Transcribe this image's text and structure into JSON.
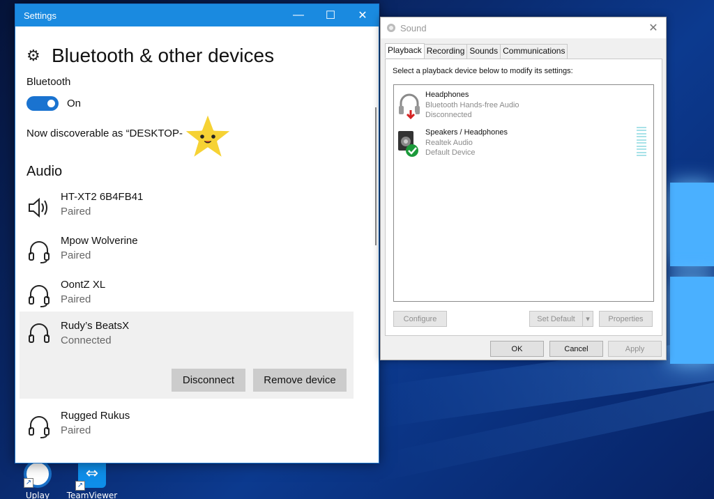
{
  "settings": {
    "window_title": "Settings",
    "page_title": "Bluetooth & other devices",
    "bluetooth_label": "Bluetooth",
    "bluetooth_state": "On",
    "discoverable_text": "Now discoverable as “DESKTOP-",
    "audio_heading": "Audio",
    "devices": [
      {
        "name": "HT-XT2 6B4FB41",
        "status": "Paired",
        "icon": "speaker-icon"
      },
      {
        "name": "Mpow Wolverine",
        "status": "Paired",
        "icon": "headset-icon"
      },
      {
        "name": "OontZ XL",
        "status": "Paired",
        "icon": "headset-icon"
      },
      {
        "name": "Rudy’s BeatsX",
        "status": "Connected",
        "icon": "headphones-icon"
      },
      {
        "name": "Rugged Rukus",
        "status": "Paired",
        "icon": "headset-icon"
      }
    ],
    "disconnect_label": "Disconnect",
    "remove_label": "Remove device"
  },
  "sound": {
    "window_title": "Sound",
    "tabs": [
      "Playback",
      "Recording",
      "Sounds",
      "Communications"
    ],
    "instruction": "Select a playback device below to modify its settings:",
    "devices": [
      {
        "name": "Headphones",
        "line2": "Bluetooth Hands-free Audio",
        "line3": "Disconnected"
      },
      {
        "name": "Speakers / Headphones",
        "line2": "Realtek Audio",
        "line3": "Default Device"
      }
    ],
    "configure_label": "Configure",
    "set_default_label": "Set Default",
    "properties_label": "Properties",
    "ok_label": "OK",
    "cancel_label": "Cancel",
    "apply_label": "Apply"
  },
  "desktop": {
    "icons": [
      {
        "label": "Uplay"
      },
      {
        "label": "TeamViewer"
      }
    ]
  },
  "colors": {
    "accent": "#1a8ae0",
    "toggle_on": "#1a73d0",
    "default_check": "#1b9a3a",
    "disconnected_arrow": "#d32222"
  }
}
